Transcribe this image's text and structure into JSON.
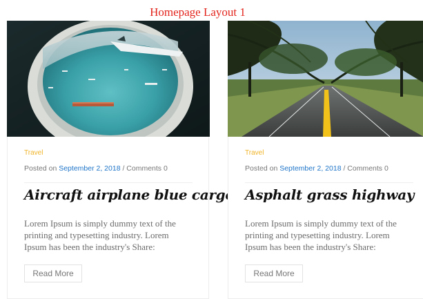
{
  "page": {
    "layout_title": "Homepage Layout 1"
  },
  "posts": [
    {
      "category": "Travel",
      "posted_on_label": "Posted on",
      "date": "September 2, 2018",
      "separator": "/",
      "comments": "Comments 0",
      "title": "Aircraft airplane blue cargo",
      "excerpt": "Lorem Ipsum is simply dummy text of the printing and typesetting industry. Lorem Ipsum has been the industry's Share:",
      "read_more": "Read More",
      "image": "airplane-window-photo"
    },
    {
      "category": "Travel",
      "posted_on_label": "Posted on",
      "date": "September 2, 2018",
      "separator": "/",
      "comments": "Comments 0",
      "title": "Asphalt grass highway",
      "excerpt": "Lorem Ipsum is simply dummy text of the printing and typesetting industry. Lorem Ipsum has been the industry's Share:",
      "read_more": "Read More",
      "image": "highway-trees-photo"
    }
  ],
  "colors": {
    "layout_title": "#e3241c",
    "category": "#f0b429",
    "date_link": "#1d74c9",
    "text_muted": "#6b6b6b"
  }
}
